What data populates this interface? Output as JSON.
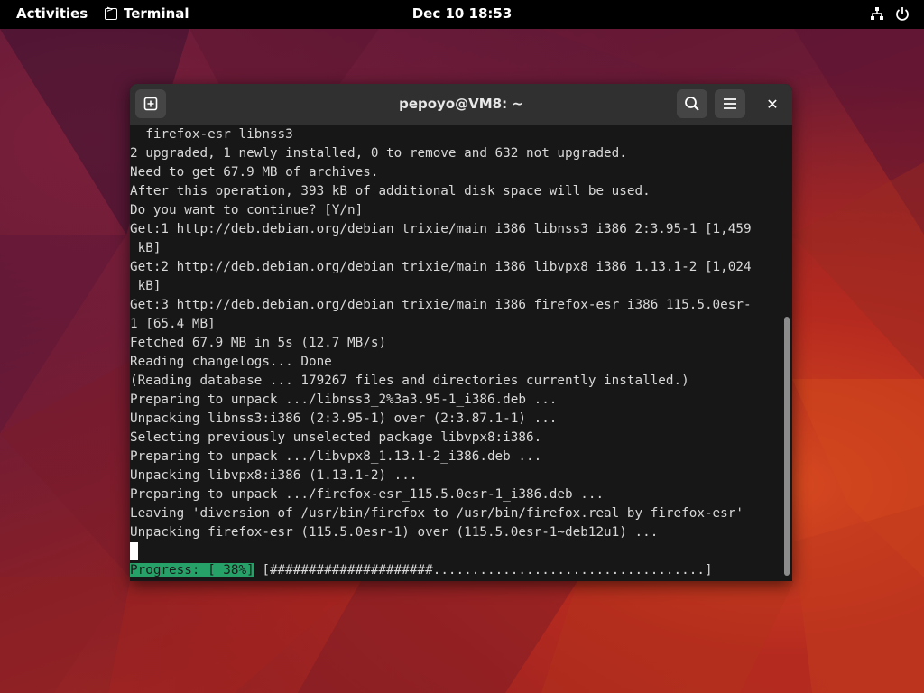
{
  "topbar": {
    "activities": "Activities",
    "app_name": "Terminal",
    "clock": "Dec 10  18:53"
  },
  "window": {
    "title": "pepoyo@VM8: ~"
  },
  "terminal": {
    "lines": [
      "  firefox-esr libnss3",
      "2 upgraded, 1 newly installed, 0 to remove and 632 not upgraded.",
      "Need to get 67.9 MB of archives.",
      "After this operation, 393 kB of additional disk space will be used.",
      "Do you want to continue? [Y/n]",
      "Get:1 http://deb.debian.org/debian trixie/main i386 libnss3 i386 2:3.95-1 [1,459",
      " kB]",
      "Get:2 http://deb.debian.org/debian trixie/main i386 libvpx8 i386 1.13.1-2 [1,024",
      " kB]",
      "Get:3 http://deb.debian.org/debian trixie/main i386 firefox-esr i386 115.5.0esr-",
      "1 [65.4 MB]",
      "Fetched 67.9 MB in 5s (12.7 MB/s)",
      "Reading changelogs... Done",
      "(Reading database ... 179267 files and directories currently installed.)",
      "Preparing to unpack .../libnss3_2%3a3.95-1_i386.deb ...",
      "Unpacking libnss3:i386 (2:3.95-1) over (2:3.87.1-1) ...",
      "Selecting previously unselected package libvpx8:i386.",
      "Preparing to unpack .../libvpx8_1.13.1-2_i386.deb ...",
      "Unpacking libvpx8:i386 (1.13.1-2) ...",
      "Preparing to unpack .../firefox-esr_115.5.0esr-1_i386.deb ...",
      "Leaving 'diversion of /usr/bin/firefox to /usr/bin/firefox.real by firefox-esr'",
      "Unpacking firefox-esr (115.5.0esr-1) over (115.5.0esr-1~deb12u1) ..."
    ],
    "progress_label": "Progress: [ 38%]",
    "progress_bar": " [#####################...................................]",
    "progress_percent": 38
  },
  "icons": {
    "new_tab": "new-tab-icon",
    "search": "search-icon",
    "menu": "hamburger-menu-icon",
    "close": "close-icon",
    "network": "network-icon",
    "power": "power-icon"
  }
}
